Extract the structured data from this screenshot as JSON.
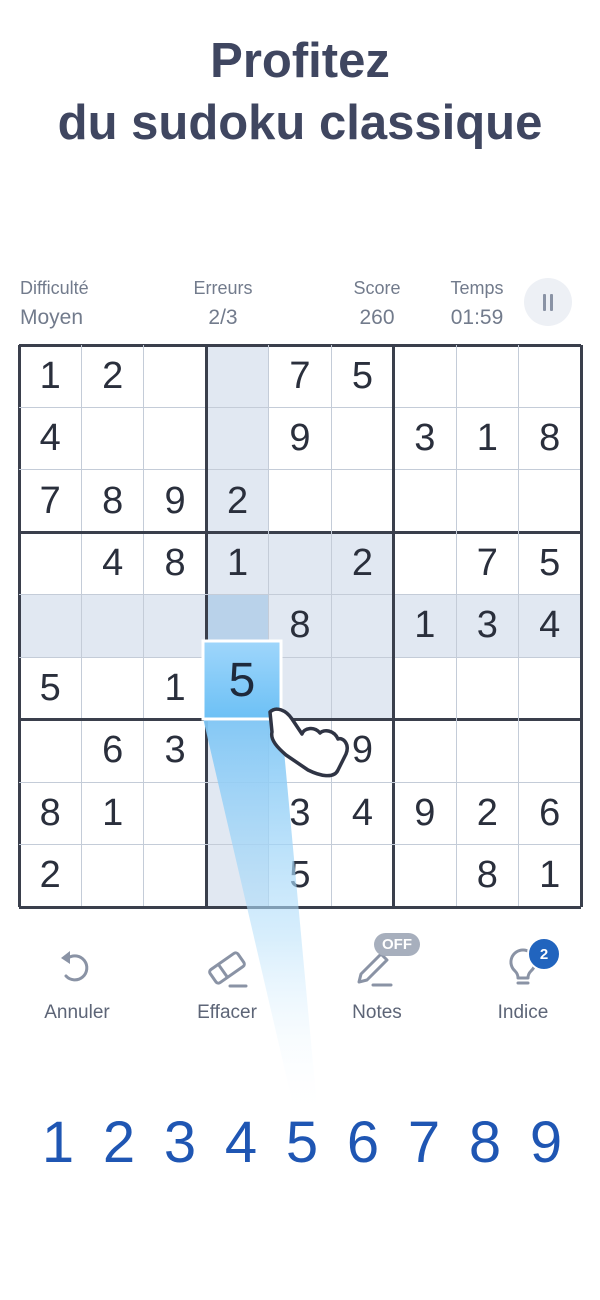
{
  "headline": {
    "line1": "Profitez",
    "line2": "du sudoku classique"
  },
  "stats": {
    "difficulty_label": "Difficulté",
    "difficulty_value": "Moyen",
    "errors_label": "Erreurs",
    "errors_value": "2/3",
    "score_label": "Score",
    "score_value": "260",
    "time_label": "Temps",
    "time_value": "01:59"
  },
  "board": [
    [
      "1",
      "2",
      "",
      "",
      "7",
      "5",
      "",
      "",
      ""
    ],
    [
      "4",
      "",
      "",
      "",
      "9",
      "",
      "3",
      "1",
      "8"
    ],
    [
      "7",
      "8",
      "9",
      "2",
      "",
      "",
      "",
      "",
      ""
    ],
    [
      "",
      "4",
      "8",
      "1",
      "",
      "2",
      "",
      "7",
      "5"
    ],
    [
      "",
      "",
      "",
      "",
      "8",
      "",
      "1",
      "3",
      "4"
    ],
    [
      "5",
      "",
      "1",
      "",
      "",
      "",
      "",
      "",
      ""
    ],
    [
      "",
      "6",
      "3",
      "",
      "",
      "9",
      "",
      "",
      ""
    ],
    [
      "8",
      "1",
      "",
      "",
      "3",
      "4",
      "9",
      "2",
      "6"
    ],
    [
      "2",
      "",
      "",
      "",
      "5",
      "",
      "",
      "8",
      "1"
    ]
  ],
  "drag_digit": "5",
  "tools": {
    "undo_label": "Annuler",
    "erase_label": "Effacer",
    "notes_label": "Notes",
    "notes_state": "OFF",
    "hint_label": "Indice",
    "hint_count": "2"
  },
  "numpad": [
    "1",
    "2",
    "3",
    "4",
    "5",
    "6",
    "7",
    "8",
    "9"
  ],
  "colors": {
    "accent": "#1f56b3",
    "highlight": "#e1e8f2",
    "selected": "#b9d2ea",
    "title": "#3f4660"
  }
}
